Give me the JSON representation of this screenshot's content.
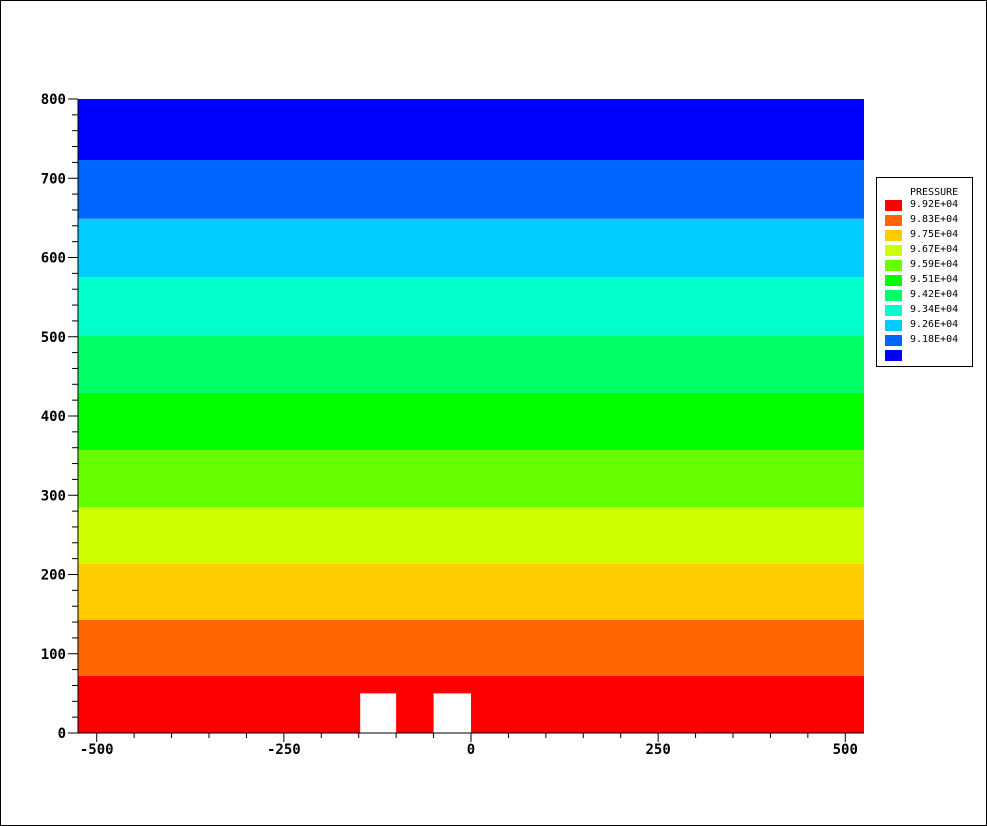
{
  "chart_data": {
    "type": "heatmap",
    "title": "",
    "xlabel": "",
    "ylabel": "",
    "xlim": [
      -525,
      525
    ],
    "ylim": [
      0,
      800
    ],
    "x_ticks": [
      -500,
      -250,
      0,
      250,
      500
    ],
    "x_tick_labels": [
      "-500",
      "-250",
      "0",
      "250",
      "500"
    ],
    "y_ticks": [
      0,
      100,
      200,
      300,
      400,
      500,
      600,
      700,
      800
    ],
    "y_tick_labels": [
      "0",
      "100",
      "200",
      "300",
      "400",
      "500",
      "600",
      "700",
      "800"
    ],
    "bands": [
      {
        "y0": 0,
        "y1": 72,
        "color": "#ff0000",
        "level": "9.92E+04"
      },
      {
        "y0": 72,
        "y1": 143,
        "color": "#ff6600",
        "level": "9.83E+04"
      },
      {
        "y0": 143,
        "y1": 214,
        "color": "#ffcc00",
        "level": "9.75E+04"
      },
      {
        "y0": 214,
        "y1": 285,
        "color": "#ccff00",
        "level": "9.67E+04"
      },
      {
        "y0": 285,
        "y1": 357,
        "color": "#66ff00",
        "level": "9.59E+04"
      },
      {
        "y0": 357,
        "y1": 429,
        "color": "#00ff00",
        "level": "9.51E+04"
      },
      {
        "y0": 429,
        "y1": 502,
        "color": "#00ff66",
        "level": "9.42E+04"
      },
      {
        "y0": 502,
        "y1": 575,
        "color": "#00ffcc",
        "level": "9.34E+04"
      },
      {
        "y0": 575,
        "y1": 649,
        "color": "#00ccff",
        "level": "9.26E+04"
      },
      {
        "y0": 649,
        "y1": 723,
        "color": "#0066ff",
        "level": "9.18E+04"
      },
      {
        "y0": 723,
        "y1": 800,
        "color": "#0000ff",
        "level": ""
      }
    ],
    "obstacles": [
      {
        "x0": -148,
        "x1": -100,
        "y0": 0,
        "y1": 50,
        "color": "#ffffff"
      },
      {
        "x0": -50,
        "x1": 0,
        "y0": 0,
        "y1": 50,
        "color": "#ffffff"
      }
    ],
    "legend": {
      "title": "PRESSURE",
      "placement": "right",
      "entries": [
        {
          "label": "9.92E+04",
          "color": "#ff0000"
        },
        {
          "label": "9.83E+04",
          "color": "#ff6600"
        },
        {
          "label": "9.75E+04",
          "color": "#ffcc00"
        },
        {
          "label": "9.67E+04",
          "color": "#ccff00"
        },
        {
          "label": "9.59E+04",
          "color": "#66ff00"
        },
        {
          "label": "9.51E+04",
          "color": "#00ff00"
        },
        {
          "label": "9.42E+04",
          "color": "#00ff66"
        },
        {
          "label": "9.34E+04",
          "color": "#00ffcc"
        },
        {
          "label": "9.26E+04",
          "color": "#00ccff"
        },
        {
          "label": "9.18E+04",
          "color": "#0066ff"
        },
        {
          "label": "",
          "color": "#0000ff"
        }
      ]
    }
  }
}
